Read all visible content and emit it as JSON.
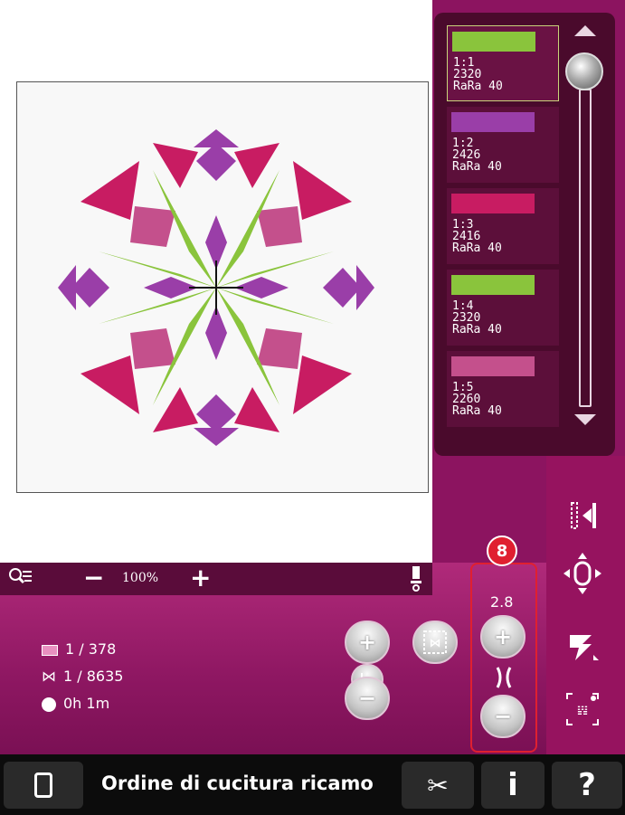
{
  "threads": [
    {
      "color": "#8ac43c",
      "line1": "1:1",
      "line2": "2320",
      "line3": "RaRa 40"
    },
    {
      "color": "#9a3ea8",
      "line1": "1:2",
      "line2": "2426",
      "line3": "RaRa 40"
    },
    {
      "color": "#c81c62",
      "line1": "1:3",
      "line2": "2416",
      "line3": "RaRa 40"
    },
    {
      "color": "#8ac43c",
      "line1": "1:4",
      "line2": "2320",
      "line3": "RaRa 40"
    },
    {
      "color": "#c4508c",
      "line1": "1:5",
      "line2": "2260",
      "line3": "RaRa 40"
    }
  ],
  "zoom": {
    "value": "100%",
    "minus": "−",
    "plus": "+"
  },
  "info": {
    "color_block": "1 / 378",
    "stitch": "1 / 8635",
    "time": "0h 1m"
  },
  "stepper": {
    "value": "2.8",
    "plus": "+",
    "minus": "−"
  },
  "callout": {
    "number": "8"
  },
  "bottom": {
    "title": "Ordine di cucitura ricamo",
    "info_label": "i",
    "help_label": "?"
  }
}
